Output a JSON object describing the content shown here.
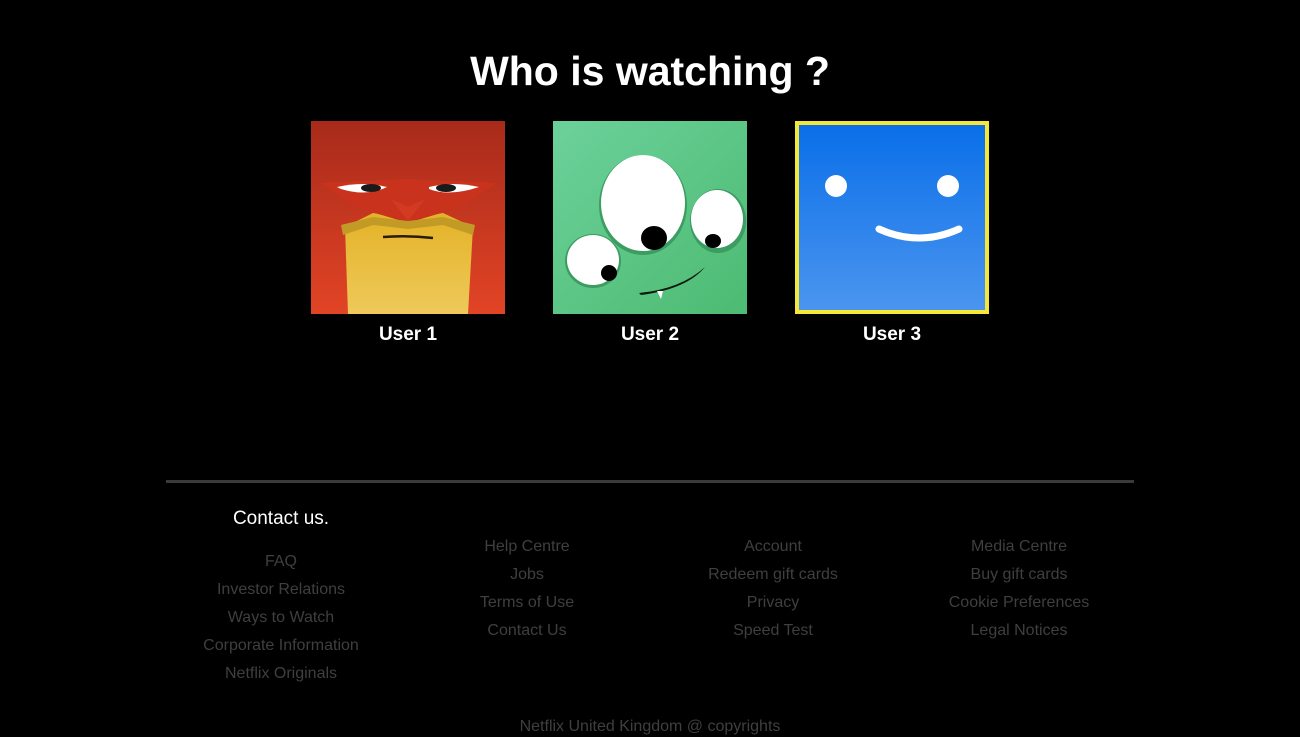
{
  "page": {
    "title": "Who is watching ?"
  },
  "profiles": [
    {
      "name": "User 1",
      "avatar_icon": "angry-red-face-icon",
      "color": "#d8341f"
    },
    {
      "name": "User 2",
      "avatar_icon": "green-three-eyed-monster-icon",
      "color": "#5ac888"
    },
    {
      "name": "User 3",
      "avatar_icon": "blue-smiley-face-icon",
      "color": "#1273e6",
      "selected_border": "#f5e63a"
    }
  ],
  "footer": {
    "contact_heading": "Contact us.",
    "columns": [
      [
        "FAQ",
        "Investor Relations",
        "Ways to Watch",
        "Corporate Information",
        "Netflix Originals"
      ],
      [
        "Help Centre",
        "Jobs",
        "Terms of Use",
        "Contact Us"
      ],
      [
        "Account",
        "Redeem gift cards",
        "Privacy",
        "Speed Test"
      ],
      [
        "Media Centre",
        "Buy gift cards",
        "Cookie Preferences",
        "Legal Notices"
      ]
    ],
    "copyright": "Netflix United Kingdom @ copyrights"
  }
}
